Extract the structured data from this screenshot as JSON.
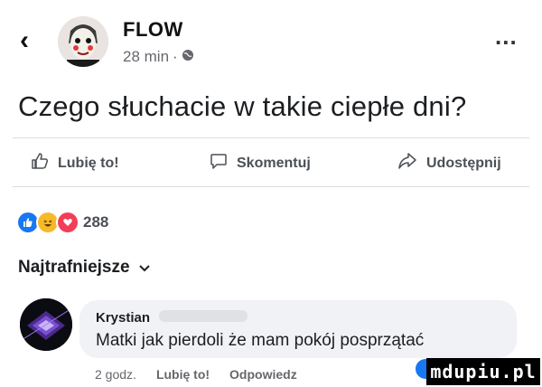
{
  "header": {
    "back_icon": "chevron-left-icon",
    "page_name": "FLOW",
    "time": "28 min",
    "separator": "·",
    "privacy_icon": "globe-icon",
    "more_icon": "more-horizontal-icon",
    "more_glyph": "..."
  },
  "post": {
    "text": "Czego słuchacie w takie ciepłe dni?"
  },
  "actions": {
    "like_label": "Lubię to!",
    "like_icon": "thumbs-up-icon",
    "comment_label": "Skomentuj",
    "comment_icon": "comment-icon",
    "share_label": "Udostępnij",
    "share_icon": "share-icon"
  },
  "reactions": {
    "icons": [
      "like-reaction-icon",
      "haha-reaction-icon",
      "love-reaction-icon"
    ],
    "count": "288"
  },
  "comments_filter": {
    "label": "Najtrafniejsze",
    "icon": "chevron-down-icon"
  },
  "comment": {
    "author": "Krystian",
    "text": "Matki jak pierdoli że mam pokój posprzątać",
    "time": "2 godz.",
    "like_label": "Lubię to!",
    "reply_label": "Odpowiedz"
  },
  "watermark": {
    "text": "mdupiu.pl"
  },
  "colors": {
    "like_blue": "#1877f2",
    "haha_yellow": "#f7b928",
    "love_red": "#f33e58",
    "secondary_text": "#65676b",
    "bubble_bg": "#f0f2f5"
  }
}
